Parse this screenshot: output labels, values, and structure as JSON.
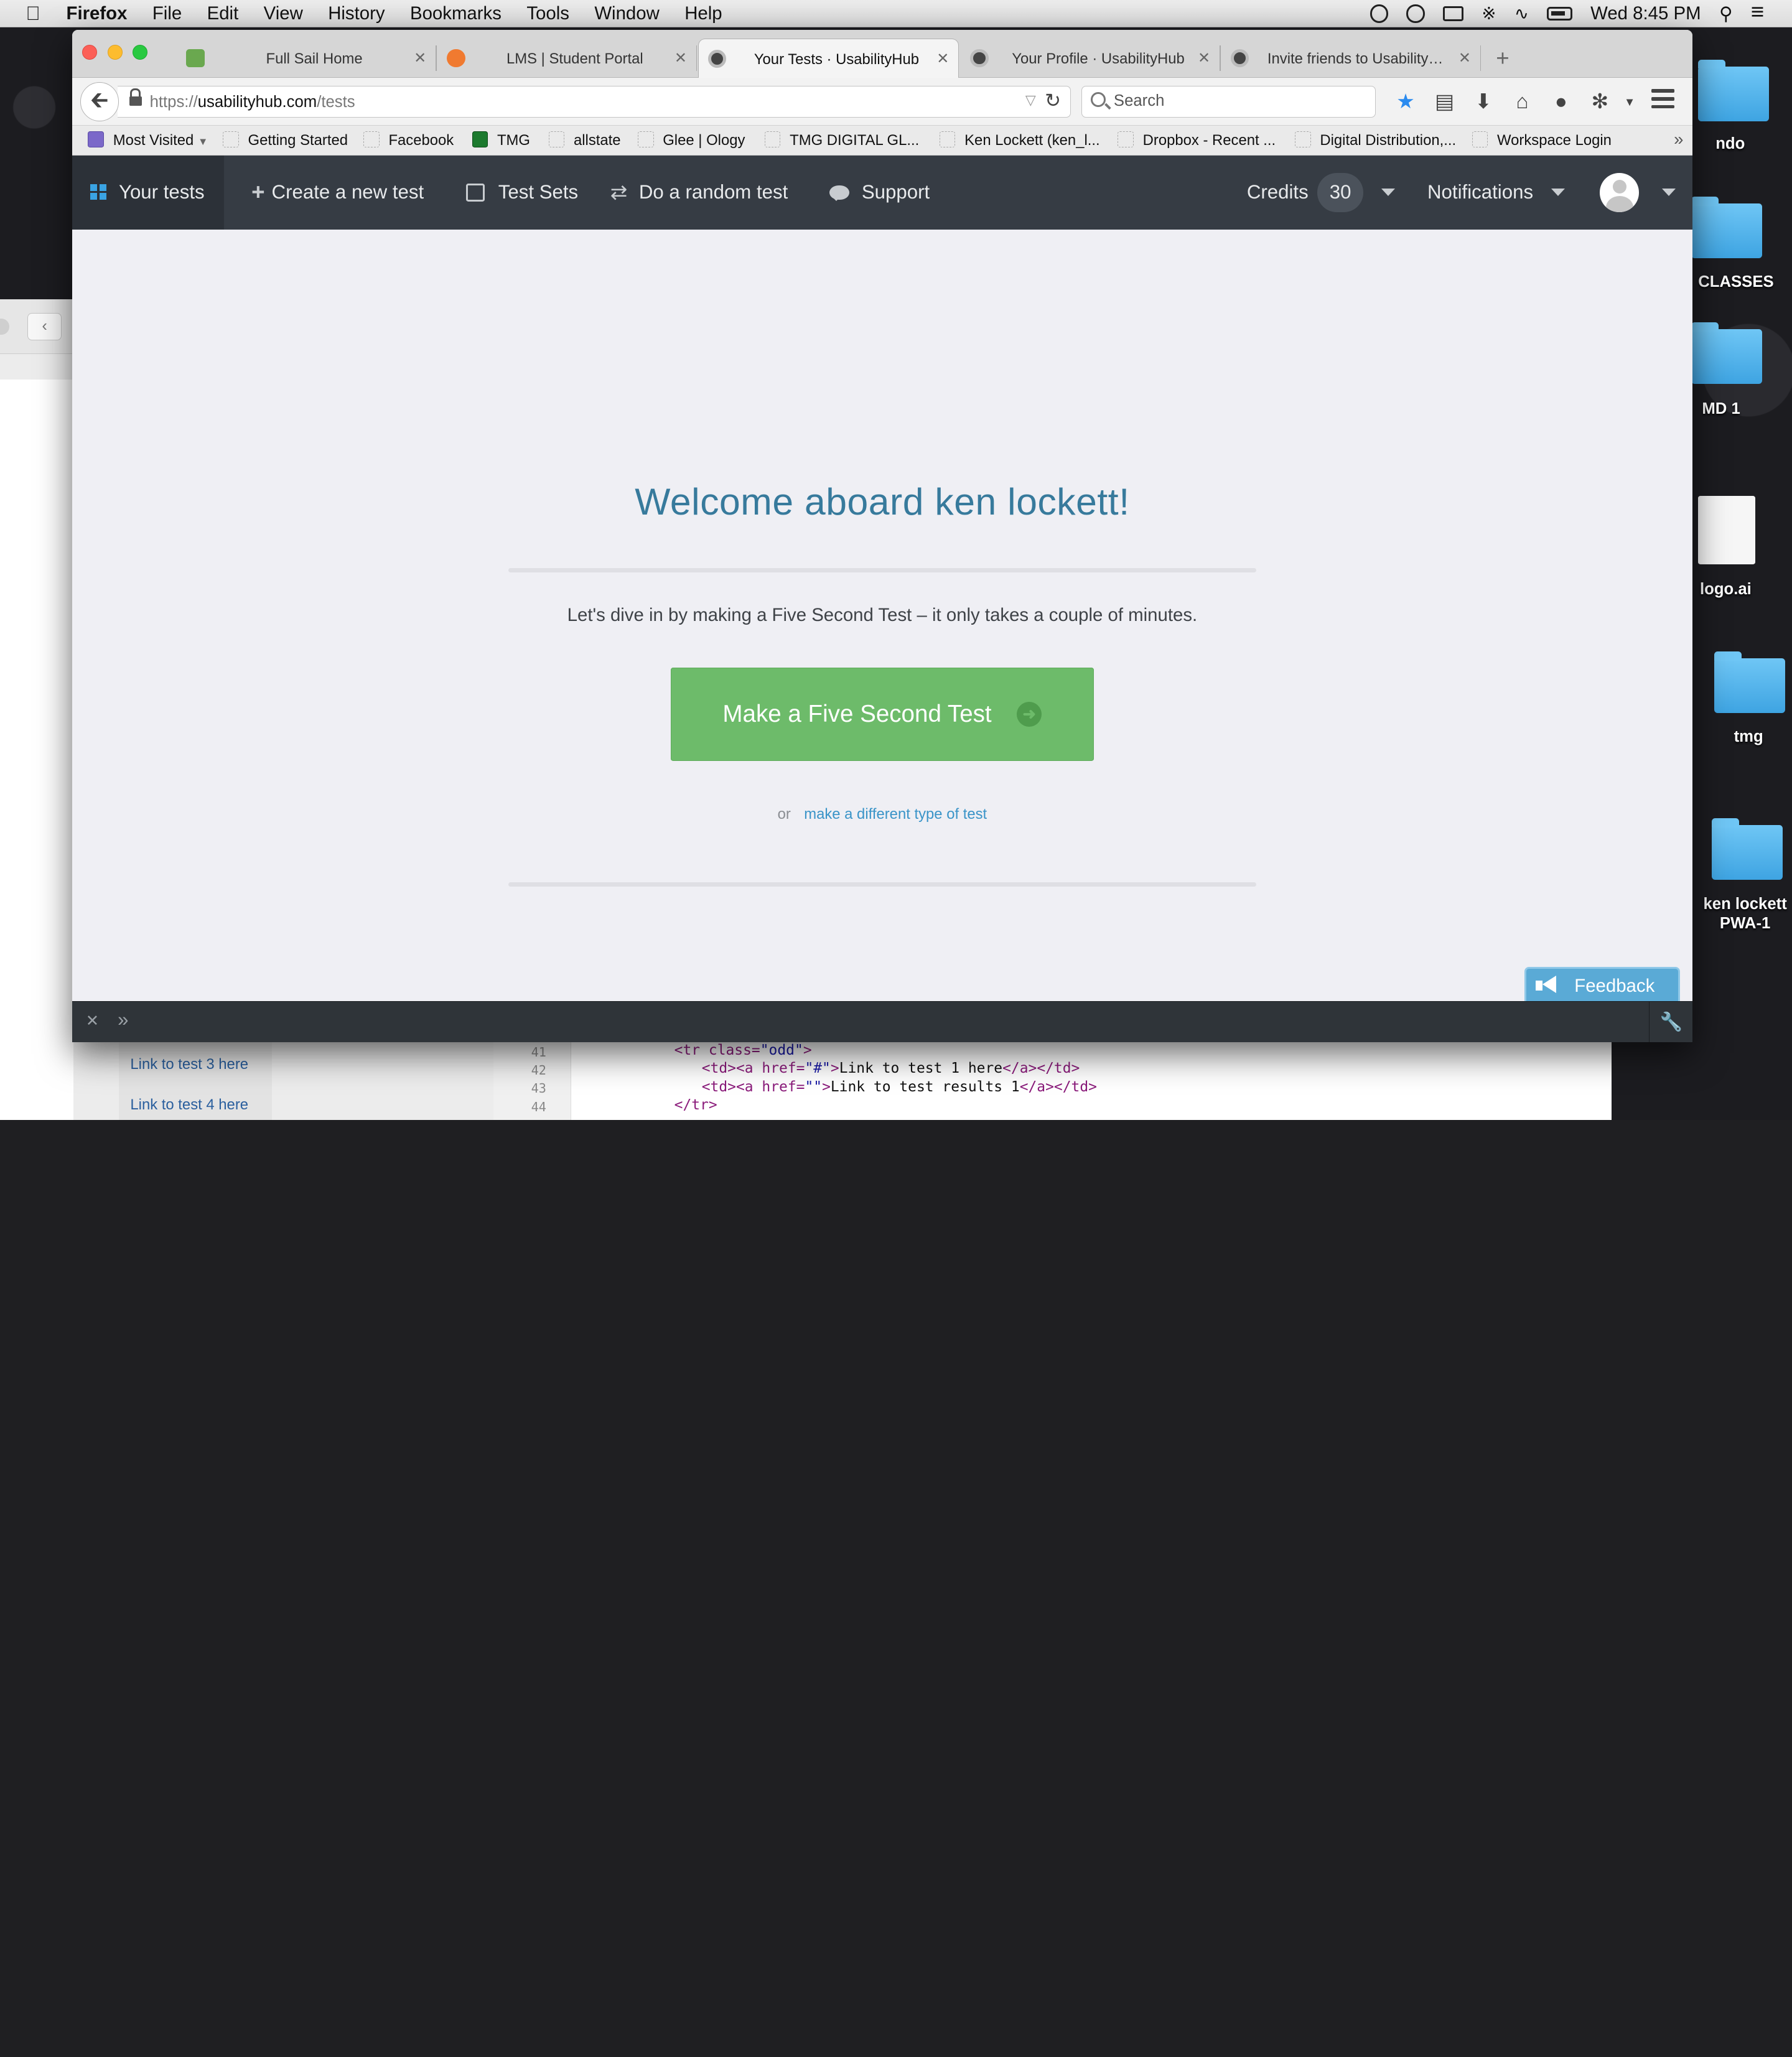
{
  "macos_menubar": {
    "app_name": "Firefox",
    "menus": [
      "File",
      "Edit",
      "View",
      "History",
      "Bookmarks",
      "Tools",
      "Window",
      "Help"
    ],
    "clock": "Wed 8:45 PM"
  },
  "desktop_icons": [
    {
      "label": "ndo"
    },
    {
      "label": "CLASSES"
    },
    {
      "label": "MD 1"
    },
    {
      "label": "logo.ai"
    },
    {
      "label": "tmg"
    },
    {
      "label": "ken lockett PWA-1"
    }
  ],
  "background_editor": {
    "links": [
      "Link to test 3 here",
      "Link to test 4 here"
    ],
    "line_numbers": [
      "41",
      "42",
      "43",
      "44"
    ],
    "code": {
      "l41_tag": "<tr class=",
      "l41_str": "\"odd\"",
      "l41_end": ">",
      "l42_tag": "<td><a href=",
      "l42_str": "\"#\"",
      "l42_gt": ">",
      "l42_txt": "Link to test 1 here",
      "l42_end": "</a></td>",
      "l43_tag": "<td><a href=",
      "l43_str": "\"\"",
      "l43_gt": ">",
      "l43_txt": "Link to test results 1",
      "l43_end": "</a></td>",
      "l44_tag": "</tr>"
    }
  },
  "browser": {
    "tabs": [
      {
        "title": "Full Sail Home",
        "favicon_color": "#6aa84f"
      },
      {
        "title": "LMS | Student Portal",
        "favicon_color": "#f07a30"
      },
      {
        "title": "Your Tests · UsabilityHub",
        "favicon_color": "#444444"
      },
      {
        "title": "Your Profile · UsabilityHub",
        "favicon_color": "#444444"
      },
      {
        "title": "Invite friends to UsabilityHu...",
        "favicon_color": "#444444"
      }
    ],
    "active_tab_index": 2,
    "url_prefix": "https://",
    "url_domain": "usabilityhub.com",
    "url_path": "/tests",
    "search_placeholder": "Search",
    "bookmarks": [
      "Most Visited",
      "Getting Started",
      "Facebook",
      "TMG",
      "allstate",
      "Glee | Ology",
      "TMG DIGITAL GL...",
      "Ken Lockett (ken_l...",
      "Dropbox - Recent ...",
      "Digital Distribution,...",
      "Workspace Login"
    ]
  },
  "site_nav": {
    "your_tests": "Your tests",
    "create_test": "Create a new test",
    "test_sets": "Test Sets",
    "random_test": "Do a random test",
    "support": "Support",
    "credits_label": "Credits",
    "credits_value": "30",
    "notifications": "Notifications"
  },
  "main": {
    "welcome": "Welcome aboard ken lockett!",
    "intro": "Let's dive in by making a Five Second Test – it only takes a couple of minutes.",
    "cta_label": "Make a Five Second Test",
    "or_label": "or",
    "alt_link": "make a different type of test"
  },
  "feedback_label": "Feedback",
  "colors": {
    "site_nav_bg": "#363c44",
    "heading_blue": "#377a9c",
    "cta_green": "#6dbb6a",
    "link_blue": "#3a94c8",
    "feedback_blue": "#5aaad6"
  }
}
